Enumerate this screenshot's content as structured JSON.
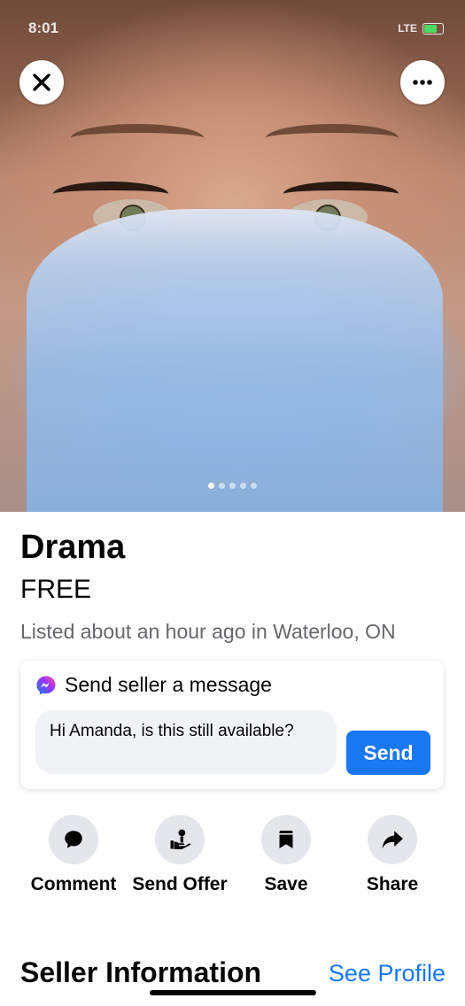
{
  "status_bar": {
    "time": "8:01",
    "network": "LTE"
  },
  "photo": {
    "page_count": 5,
    "active_index": 0
  },
  "listing": {
    "title": "Drama",
    "price": "FREE",
    "listed": "Listed about an hour ago in Waterloo, ON"
  },
  "message": {
    "heading": "Send seller a message",
    "input_value": "Hi Amanda, is this still available?",
    "send_label": "Send"
  },
  "actions": [
    {
      "label": "Comment",
      "icon": "comment-icon"
    },
    {
      "label": "Send Offer",
      "icon": "offer-icon"
    },
    {
      "label": "Save",
      "icon": "bookmark-icon"
    },
    {
      "label": "Share",
      "icon": "share-icon"
    }
  ],
  "seller": {
    "heading": "Seller Information",
    "see_profile": "See Profile"
  },
  "colors": {
    "accent": "#1877f2",
    "icon_bg": "#e4e6eb",
    "muted_text": "#65676b"
  }
}
